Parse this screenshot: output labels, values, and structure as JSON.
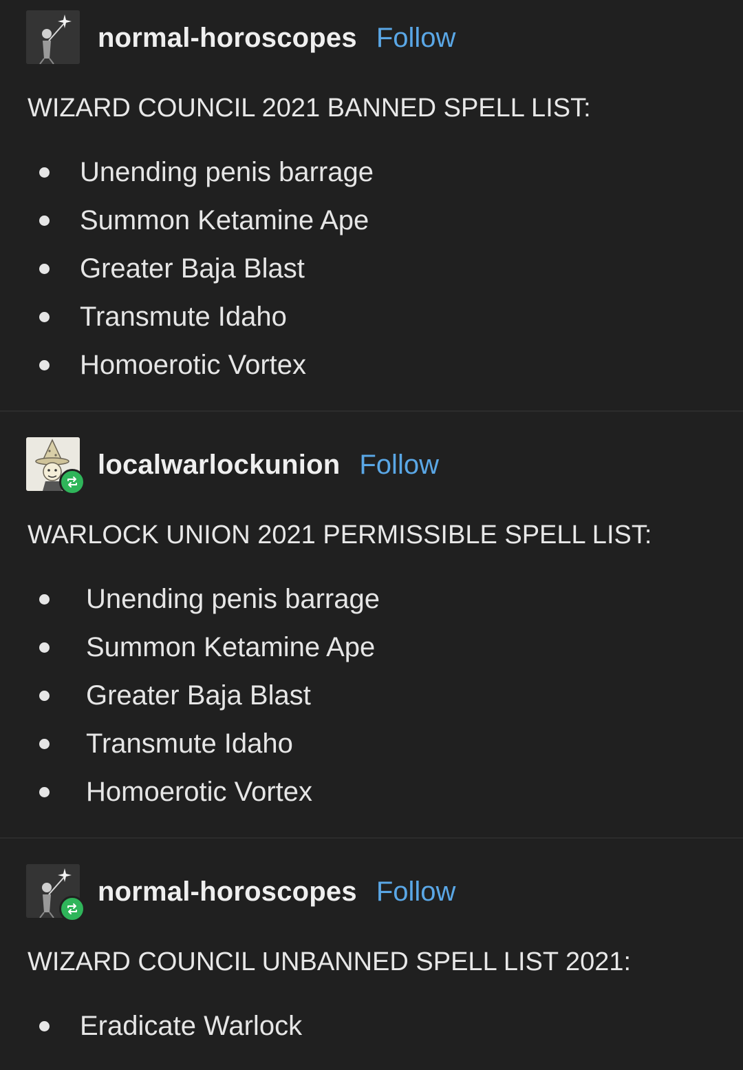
{
  "posts": [
    {
      "username": "normal-horoscopes",
      "follow_label": "Follow",
      "title": "WIZARD COUNCIL 2021 BANNED SPELL LIST:",
      "spells": [
        "Unending penis barrage",
        "Summon Ketamine Ape",
        "Greater Baja Blast",
        "Transmute Idaho",
        "Homoerotic Vortex"
      ]
    },
    {
      "username": "localwarlockunion",
      "follow_label": "Follow",
      "title": "WARLOCK UNION 2021 PERMISSIBLE SPELL LIST:",
      "spells": [
        "Unending penis barrage",
        "Summon Ketamine Ape",
        "Greater Baja Blast",
        "Transmute Idaho",
        "Homoerotic Vortex"
      ]
    },
    {
      "username": "normal-horoscopes",
      "follow_label": "Follow",
      "title": "WIZARD COUNCIL UNBANNED SPELL LIST 2021:",
      "spells": [
        "Eradicate Warlock"
      ]
    }
  ],
  "colors": {
    "background": "#202020",
    "follow_link": "#5aa7e6",
    "reblog_badge": "#2fb55a"
  }
}
